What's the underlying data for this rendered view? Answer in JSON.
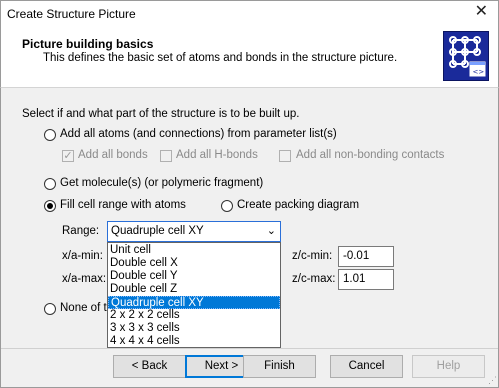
{
  "window": {
    "title": "Create Structure Picture",
    "close_glyph": "✕"
  },
  "header": {
    "title": "Picture building basics",
    "subtitle": "This defines the basic set of atoms and bonds in the structure picture.",
    "icon": "grid-structure-icon"
  },
  "main": {
    "prompt": "Select if and what part of the structure is to be built up.",
    "options": {
      "add_all_atoms": {
        "label": "Add all atoms (and connections) from parameter list(s)",
        "selected": false
      },
      "get_molecule": {
        "label": "Get molecule(s) (or polymeric fragment)",
        "selected": false
      },
      "fill_cell": {
        "label": "Fill cell range with atoms",
        "selected": true
      },
      "packing": {
        "label": "Create packing diagram",
        "selected": false
      },
      "none": {
        "label": "None of th",
        "selected": false
      }
    },
    "checkboxes": {
      "all_bonds": {
        "label": "Add all bonds",
        "checked": true,
        "mark": "✓"
      },
      "all_hbonds": {
        "label": "Add all H-bonds",
        "checked": false
      },
      "all_nonbonding": {
        "label": "Add all non-bonding contacts",
        "checked": false
      }
    },
    "range": {
      "label": "Range:",
      "value": "Quadruple cell XY",
      "arrow": "⌄",
      "options": [
        "Unit cell",
        "Double cell X",
        "Double cell Y",
        "Double cell Z",
        "Quadruple cell XY",
        "2 x 2 x 2 cells",
        "3 x 3 x 3 cells",
        "4 x 4 x 4 cells"
      ],
      "selected_index": 4
    },
    "limits": {
      "xa_min_label": "x/a-min:",
      "xa_max_label": "x/a-max:",
      "zc_min_label": "z/c-min:",
      "zc_min_value": "-0.01",
      "zc_max_label": "z/c-max:",
      "zc_max_value": "1.01"
    }
  },
  "footer": {
    "back": "< Back",
    "next": "Next >",
    "finish": "Finish",
    "cancel": "Cancel",
    "help": "Help"
  }
}
